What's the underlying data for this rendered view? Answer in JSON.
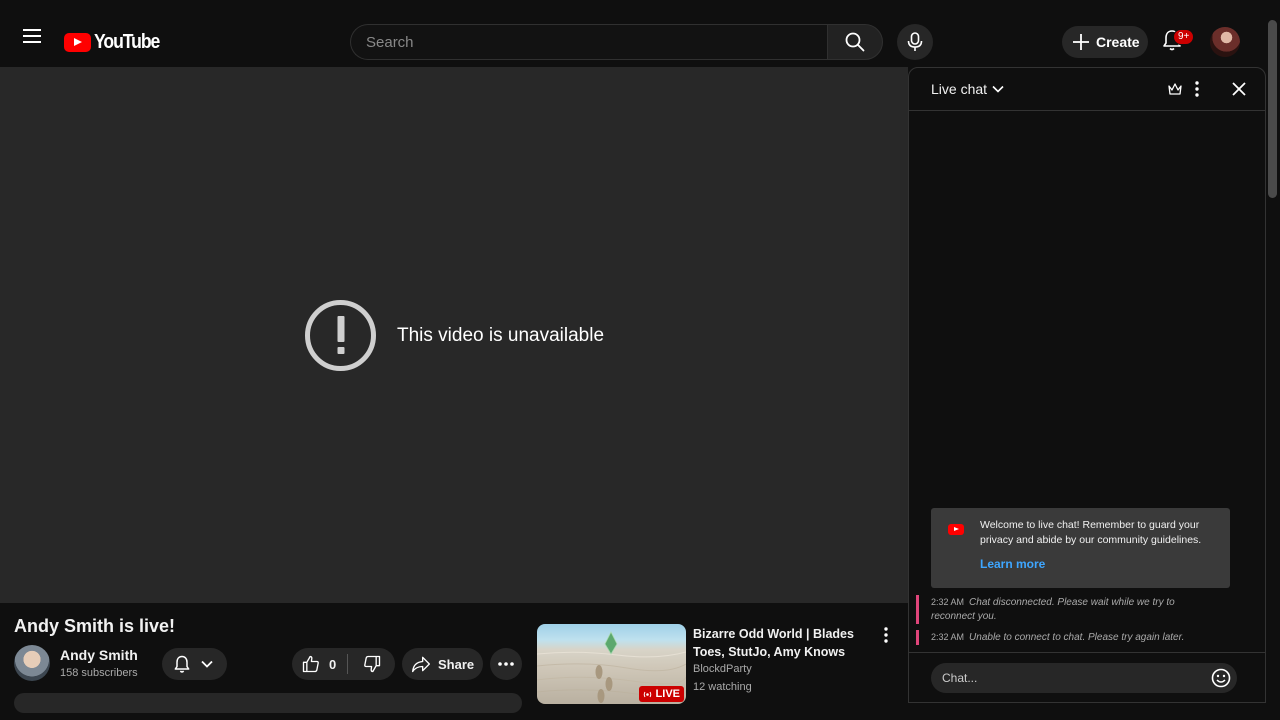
{
  "header": {
    "logo_text": "YouTube",
    "search_placeholder": "Search",
    "create_label": "Create",
    "notification_badge": "9+"
  },
  "player": {
    "error_message": "This video is unavailable"
  },
  "video": {
    "title": "Andy Smith is live!",
    "channel_name": "Andy Smith",
    "subscribers": "158 subscribers",
    "like_count": "0",
    "share_label": "Share"
  },
  "recommendation": {
    "title": "Bizarre Odd World | Blades Toes, StutJo, Amy Knows",
    "channel": "BlockdParty",
    "views": "12 watching",
    "live_label": "LIVE"
  },
  "chat": {
    "title": "Live chat",
    "welcome_text": "Welcome to live chat! Remember to guard your privacy and abide by our community guidelines.",
    "learn_more": "Learn more",
    "messages": [
      {
        "time": "2:32 AM",
        "text": "Chat disconnected. Please wait while we try to reconnect you."
      },
      {
        "time": "2:32 AM",
        "text": "Unable to connect to chat. Please try again later."
      }
    ],
    "input_placeholder": "Chat..."
  },
  "colors": {
    "accent_red": "#ff0000",
    "link_blue": "#3ea6ff",
    "system_msg_border": "#e0457a"
  }
}
